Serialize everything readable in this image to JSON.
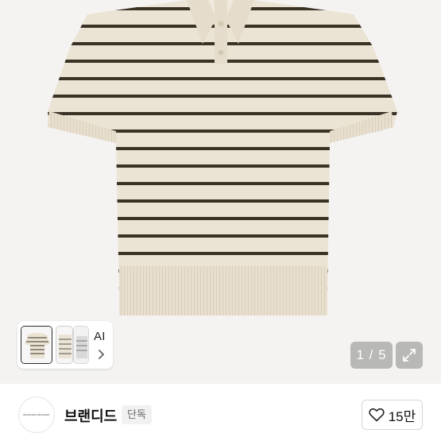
{
  "gallery": {
    "ai_label": "AI",
    "page_indicator": "1 / 5",
    "current_page": 1,
    "total_pages": 5
  },
  "seller": {
    "name": "브랜디드",
    "badge": "단독",
    "avatar_text": "BRANDED BRANDED"
  },
  "actions": {
    "like_count": "15만"
  },
  "colors": {
    "shirt_base": "#ebe3d4",
    "stripe": "#3b3226",
    "background": "#f4f3f2"
  },
  "icons": [
    "chevron-right-icon",
    "expand-icon",
    "heart-icon"
  ]
}
